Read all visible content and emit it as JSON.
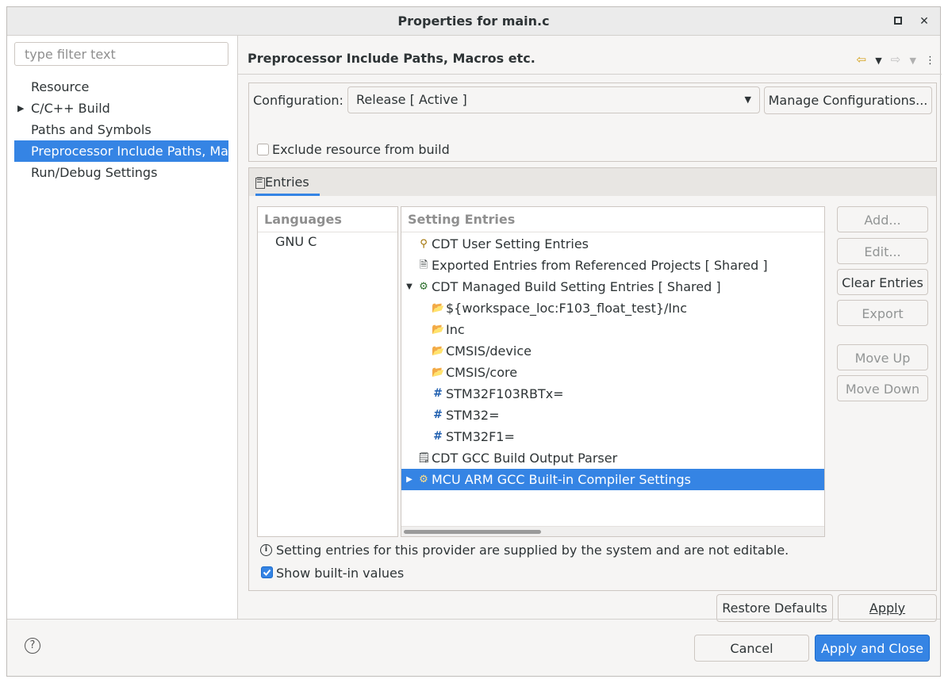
{
  "window": {
    "title": "Properties for main.c"
  },
  "left": {
    "filter_placeholder": "type filter text",
    "tree": [
      {
        "label": "Resource"
      },
      {
        "label": "C/C++ Build"
      },
      {
        "label": "Paths and Symbols"
      },
      {
        "label": "Preprocessor Include Paths, Macros etc."
      },
      {
        "label": "Run/Debug Settings"
      }
    ]
  },
  "page": {
    "title": "Preprocessor Include Paths, Macros etc.",
    "configuration_label": "Configuration:",
    "configuration_value": "Release  [ Active ]",
    "manage_button": "Manage Configurations...",
    "exclude_label": "Exclude resource from build",
    "tab_label": "Entries",
    "languages_header": "Languages",
    "languages": [
      "GNU C"
    ],
    "entries_header": "Setting Entries",
    "entries": [
      {
        "label": "CDT User Setting Entries",
        "icon": "user-icon"
      },
      {
        "label": "Exported Entries from Referenced Projects   [ Shared ]",
        "icon": "exported-icon"
      },
      {
        "label": "CDT Managed Build Setting Entries   [ Shared ]",
        "icon": "managed-icon"
      },
      {
        "label": "${workspace_loc:F103_float_test}/Inc",
        "icon": "include-folder-icon"
      },
      {
        "label": "Inc",
        "icon": "include-folder-icon"
      },
      {
        "label": "CMSIS/device",
        "icon": "include-folder-icon"
      },
      {
        "label": "CMSIS/core",
        "icon": "include-folder-icon"
      },
      {
        "label": "STM32F103RBTx=",
        "icon": "macro-icon"
      },
      {
        "label": "STM32=",
        "icon": "macro-icon"
      },
      {
        "label": "STM32F1=",
        "icon": "macro-icon"
      },
      {
        "label": "CDT GCC Build Output Parser",
        "icon": "parser-icon"
      },
      {
        "label": "MCU ARM GCC Built-in Compiler Settings",
        "icon": "compiler-icon"
      }
    ],
    "side_buttons": {
      "add": "Add...",
      "edit": "Edit...",
      "clear": "Clear Entries",
      "export": "Export",
      "move_up": "Move Up",
      "move_down": "Move Down"
    },
    "info_text": "Setting entries for this provider are supplied by the system and are not editable.",
    "show_builtin_label": "Show built-in values"
  },
  "buttons": {
    "restore_defaults": "Restore Defaults",
    "apply": "Apply",
    "cancel": "Cancel",
    "apply_close": "Apply and Close"
  },
  "colors": {
    "accent": "#3584e4"
  }
}
